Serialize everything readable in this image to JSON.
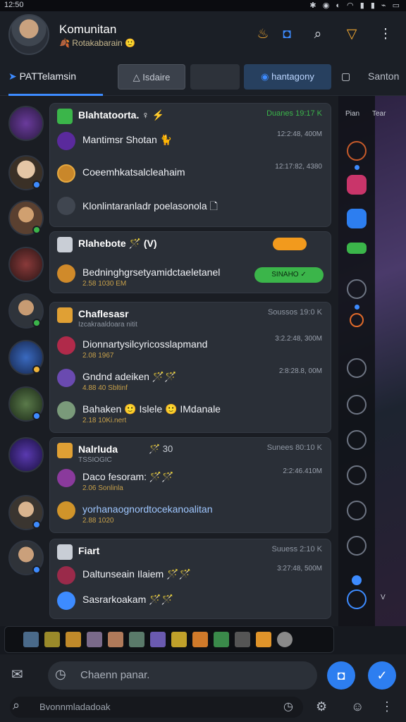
{
  "status": {
    "time": "12:50",
    "icons": "✱ ◉ ◐ ◠ ▮ ▮ ⌁ ▭"
  },
  "header": {
    "title": "Komunitan",
    "subtitle": "🍂 Rotakabarain 🙂",
    "icons": [
      "flame-icon",
      "camera-icon",
      "search-icon",
      "badge-icon",
      "more-icon"
    ]
  },
  "tabs": {
    "first": "PATTelamsin",
    "pill1": "Isdaire",
    "pill2": "",
    "pill3": "hantagony",
    "right1": "▢",
    "right2": "Santon"
  },
  "cards": [
    {
      "title": "Blahtatoorta. ♀ ⚡",
      "meta": "Duanes 19:17 K",
      "rows": [
        {
          "text": "Mantimsr Shotan 🐈",
          "sub": "",
          "time": "12:2:48, 400M"
        },
        {
          "text": "Coeemhkatsalcleahaim",
          "sub": "",
          "time": "12:17:82, 4380"
        },
        {
          "text": "Klonlintaranladr poelasonola 🗋",
          "sub": "",
          "time": ""
        }
      ]
    },
    {
      "title": "Rlahebote 🪄 (V)",
      "meta": "",
      "pill": "",
      "green": "SINAHO ✓",
      "rows": [
        {
          "text": "Bedninghgrsetyamidctaeletanel",
          "sub": "2.58 1030 EM",
          "time": ""
        }
      ]
    },
    {
      "title": "Chaflesasr",
      "subtitle": "Izcakraaldoara nitit",
      "meta": "Soussos 19:0 K",
      "rows": [
        {
          "text": "Dionnartysilcyricosslapmand",
          "sub": "2.08 1967",
          "time": "3:2.2:48, 300M"
        },
        {
          "text": "Gndnd adeiken 🪄🪄",
          "sub": "4.88 40 Sbltinf",
          "time": "2:8:28.8, 00M"
        },
        {
          "text": "Bahaken 🙂 Islele 🙂 IMdanale",
          "sub": "2.18 10Ki.nert",
          "time": ""
        }
      ]
    },
    {
      "title": "Nalrluda",
      "subtitle": "TSSIOGIC",
      "extra": "🪄 30",
      "meta": "Sunees 80:10 K",
      "rows": [
        {
          "text": "Daco fesoram: 🪄🪄",
          "sub": "2.06 Sonlinla",
          "time": "2:2:46.410M"
        },
        {
          "text": "yorhanaognordtocekanoalitan",
          "sub": "2.88 1020",
          "time": ""
        }
      ]
    },
    {
      "title": "Fiart",
      "meta": "Suuess 2:10 K",
      "rows": [
        {
          "text": "Daltunseain Ilaiem 🪄🪄",
          "sub": "",
          "time": "3:27:48, 500M"
        },
        {
          "text": "Sasrarkoakam 🪄🪄",
          "sub": "",
          "time": ""
        }
      ]
    }
  ],
  "rightpanel": {
    "label1": "Pian",
    "label2": "Tear"
  },
  "composer": {
    "placeholder": "Chaenn panar.",
    "search_placeholder": "Bvonnmladadoak"
  }
}
